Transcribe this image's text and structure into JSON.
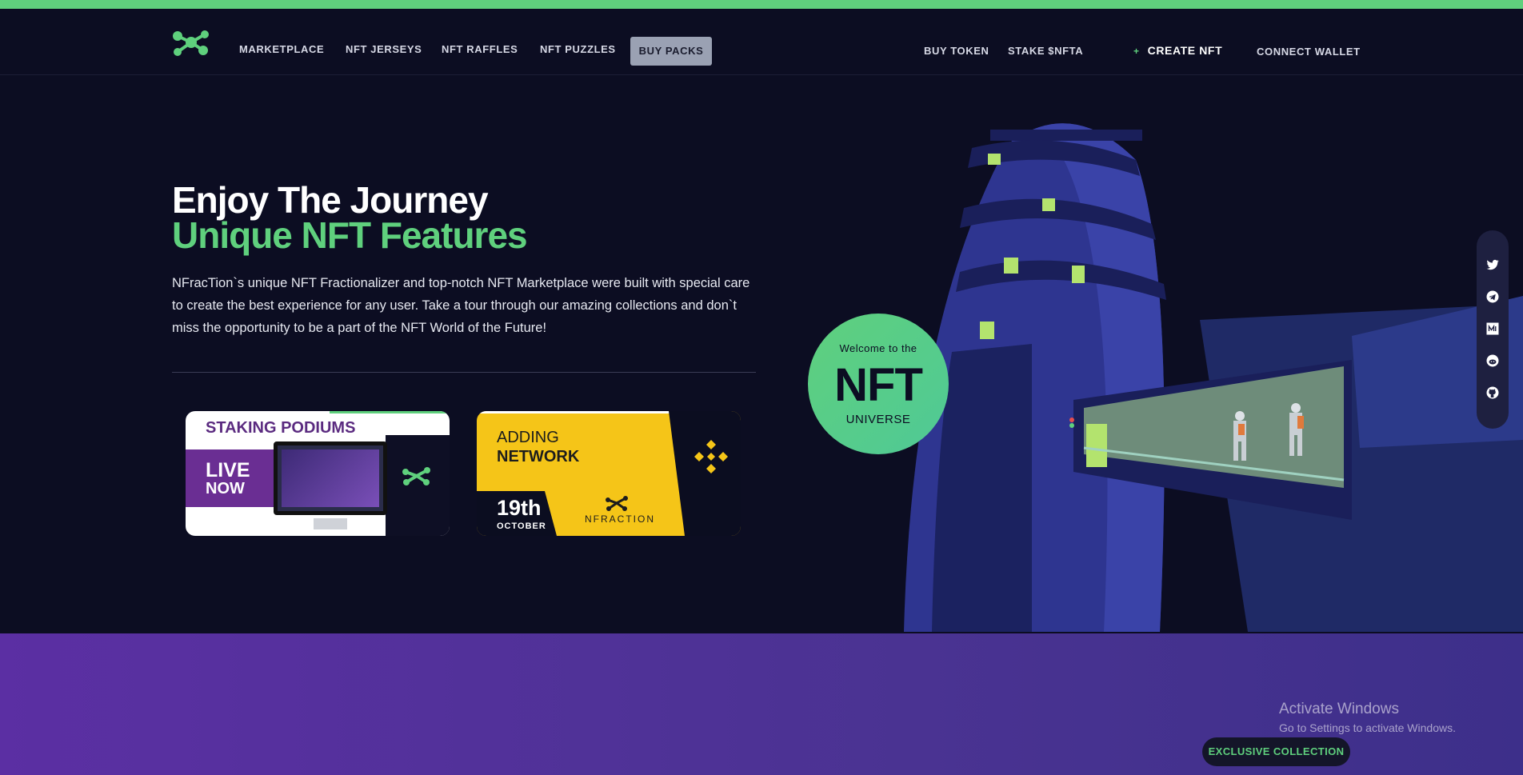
{
  "nav": {
    "items": [
      "MARKETPLACE",
      "NFT JERSEYS",
      "NFT RAFFLES",
      "NFT PUZZLES"
    ],
    "buy_packs": "BUY PACKS",
    "buy_token": "BUY TOKEN",
    "stake": "STAKE $NFTA",
    "create_plus": "+",
    "create": "CREATE NFT",
    "connect": "CONNECT WALLET"
  },
  "hero": {
    "title_line1": "Enjoy The Journey",
    "title_line2": "Unique NFT Features",
    "description": "NFracTion`s unique NFT Fractionalizer and top-notch NFT Marketplace were built with special care to create the best experience for any user. Take a tour through our amazing collections and don`t miss the opportunity to be a part of the NFT World of the Future!"
  },
  "banner_staking": {
    "title": "STAKING PODIUMS",
    "live": "LIVE",
    "now": "NOW"
  },
  "banner_network": {
    "adding": "ADDING",
    "network": "NETWORK",
    "date_day": "19th",
    "date_month": "OCTOBER",
    "brand": "NFRACTION"
  },
  "badge": {
    "welcome": "Welcome to the",
    "nft": "NFT",
    "universe": "UNIVERSE"
  },
  "social": {
    "icons": [
      "twitter-icon",
      "telegram-icon",
      "medium-icon",
      "reddit-icon",
      "github-icon"
    ]
  },
  "watermark": {
    "line1": "Activate Windows",
    "line2": "Go to Settings to activate Windows."
  },
  "exclusive": "EXCLUSIVE COLLECTION",
  "colors": {
    "accent": "#5fd07d",
    "background": "#0c0d22",
    "purple": "#5b2fa3",
    "binance_yellow": "#f5c518"
  }
}
